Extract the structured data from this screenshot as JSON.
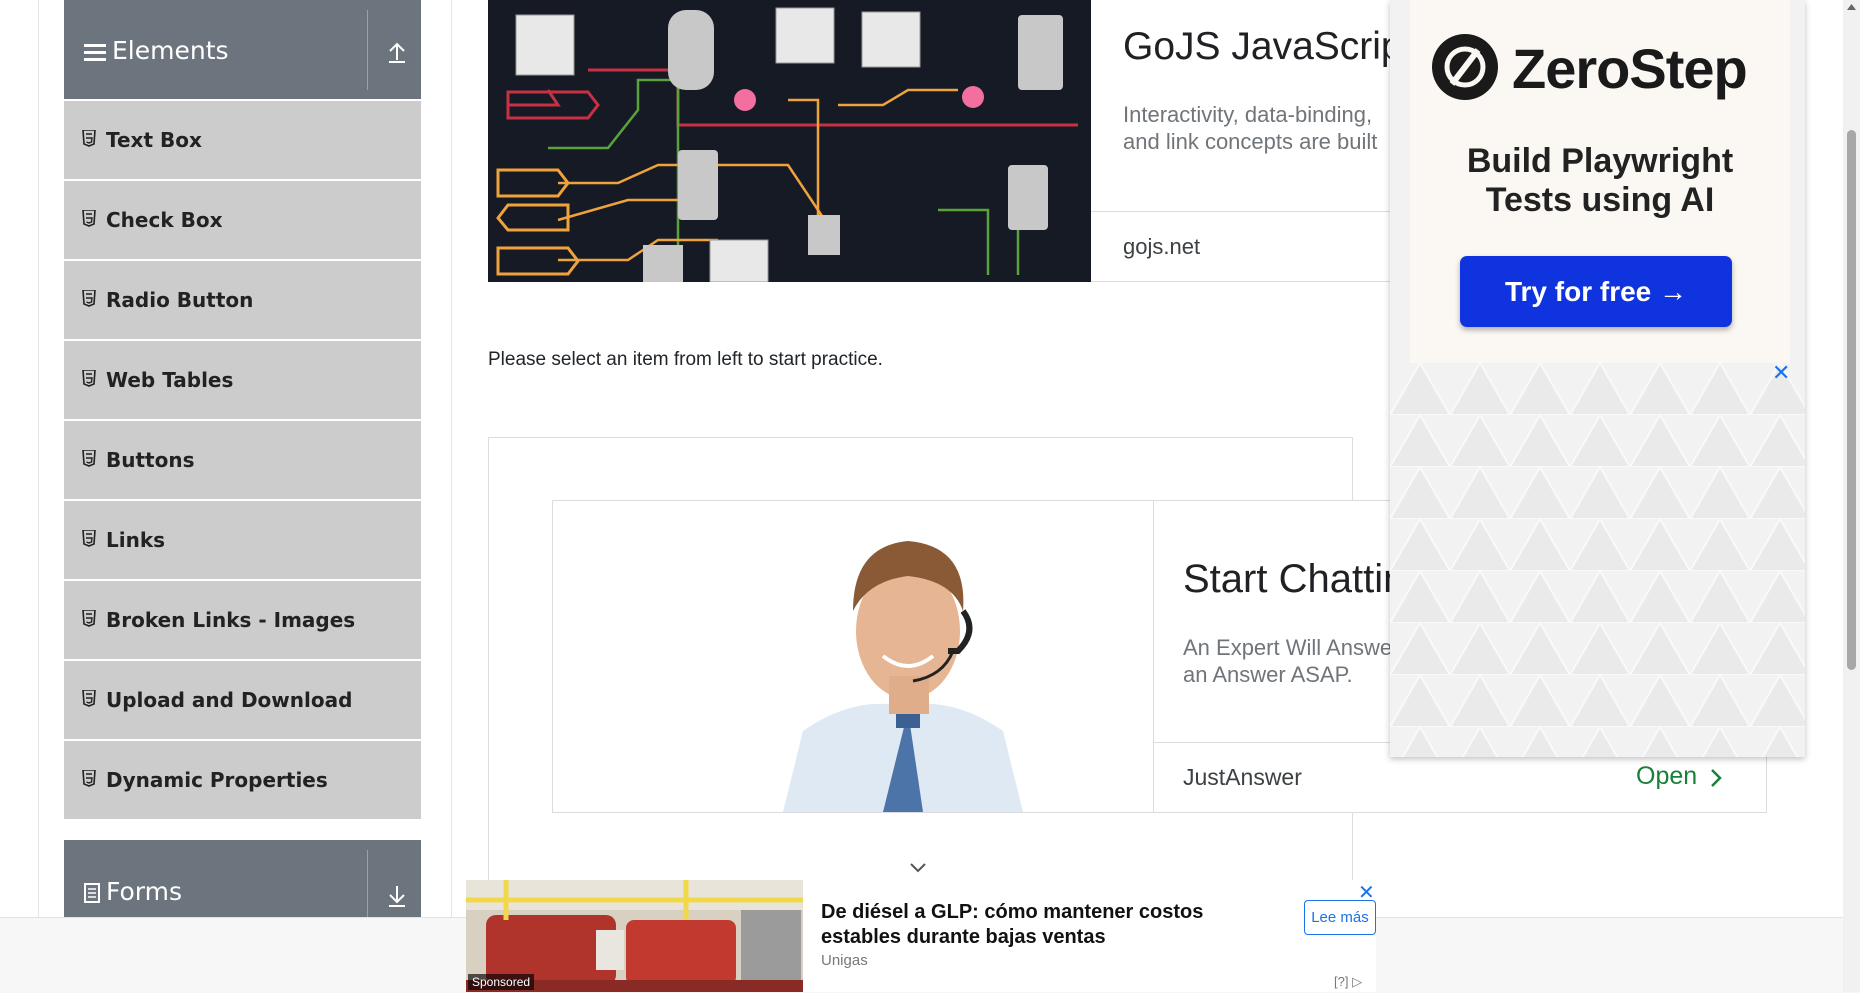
{
  "sidebar": {
    "elements_header": "Elements",
    "forms_header": "Forms",
    "items": [
      {
        "label": "Text Box"
      },
      {
        "label": "Check Box"
      },
      {
        "label": "Radio Button"
      },
      {
        "label": "Web Tables"
      },
      {
        "label": "Buttons"
      },
      {
        "label": "Links"
      },
      {
        "label": "Broken Links - Images"
      },
      {
        "label": "Upload and Download"
      },
      {
        "label": "Dynamic Properties"
      }
    ]
  },
  "main": {
    "instruction": "Please select an item from left to start practice."
  },
  "ads": {
    "gojs": {
      "title": "GoJS JavaScript",
      "desc_line1": "Interactivity, data-binding,",
      "desc_line2": "and link concepts are built",
      "domain": "gojs.net"
    },
    "justanswer": {
      "title": "Start Chatting",
      "desc_line1": "An Expert Will Answer",
      "desc_line2": "an Answer ASAP.",
      "brand": "JustAnswer",
      "cta": "Open"
    },
    "zerostep": {
      "brand": "ZeroStep",
      "tagline_line1": "Build Playwright",
      "tagline_line2": "Tests using AI",
      "cta": "Try for free →",
      "close": "✕"
    },
    "bottom": {
      "title": "De diésel a GLP: cómo mantener costos estables durante bajas ventas",
      "brand": "Unigas",
      "cta": "Lee más",
      "sponsored": "Sponsored",
      "adchoices": "[?]",
      "close": "✕"
    }
  },
  "colors": {
    "header_bg": "#6c757d",
    "menu_bg": "#cccccc",
    "zerostep_button": "#1033e0",
    "open_green": "#188038"
  }
}
